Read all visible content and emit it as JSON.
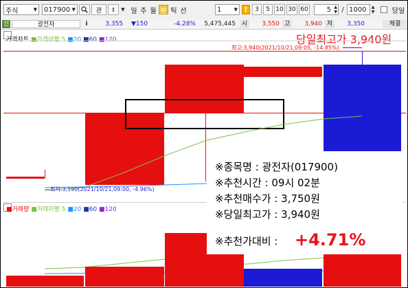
{
  "toolbar": {
    "market": "주식",
    "code": "017900",
    "search_icon": "search-icon",
    "gwan": "관",
    "updown_icon": "updown-arrow-icon",
    "period_day": "일",
    "period_week": "주",
    "period_month": "월",
    "period_minute": "분",
    "period_tick": "틱",
    "period_sec": "선",
    "interval_value": "1",
    "warn_icon": "warning-icon",
    "intervals": [
      "3",
      "5",
      "10",
      "30",
      "60"
    ],
    "count_value": "5",
    "slash": "/",
    "max_count": "1000",
    "day_label": "당일"
  },
  "infobar": {
    "sin": "신",
    "name": "광전자",
    "info_icon": "i",
    "price": "3,355",
    "change": "▼150",
    "change_rate": "-4.28%",
    "volume": "5,475,445",
    "open_label": "시",
    "open": "3,550",
    "high_label": "고",
    "high": "3,940",
    "low_label": "저",
    "low": "3,350",
    "trade_label": "체결"
  },
  "price_panel": {
    "tab": "가격차트",
    "legend_main": "가격이평",
    "ma": [
      "5",
      "20",
      "60",
      "120"
    ],
    "headline": "당일최고가 3,940원",
    "high_note": "최고:3,940(2021/10/21,09:05, -14.85%)",
    "low_note": "최저:3,590(2021/10/21,09:00, -4.96%)"
  },
  "volume_panel": {
    "tab": "거래량",
    "legend_main": "거래이평",
    "ma": [
      "5",
      "20",
      "60",
      "120"
    ]
  },
  "popup": {
    "line1": "※종목명 : 광전자(017900)",
    "line2": "※추천시간 : 09시 02분",
    "line3": "※추천매수가 : 3,750원",
    "line4": "※당일최고가 : 3,940원",
    "label": "※추천가대비 :",
    "rate": "+4.71%"
  },
  "colors": {
    "up": "#e60f0f",
    "down": "#1b1bd6",
    "ma5": "#7ac143",
    "ma20": "#1e90ff",
    "headline": "#e8131c"
  }
}
